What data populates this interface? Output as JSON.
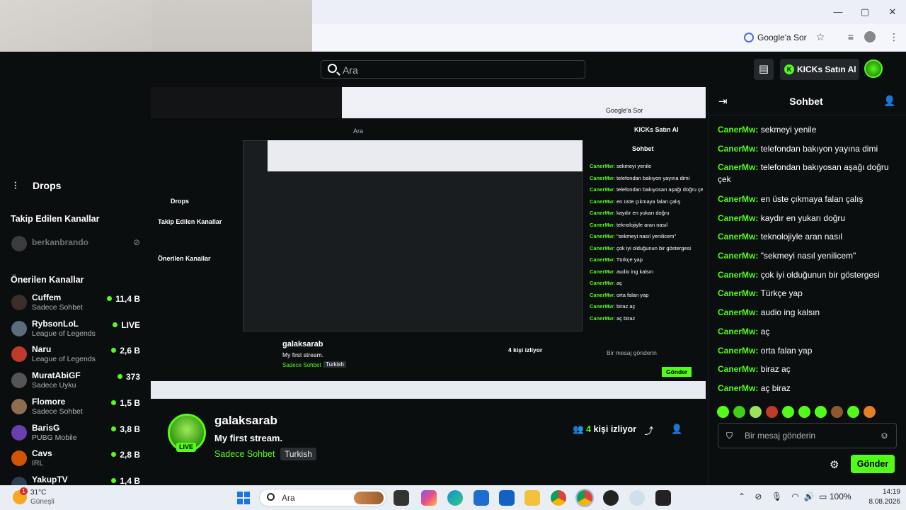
{
  "browser": {
    "google_sor": "Google'a Sor",
    "minimize": "—",
    "maximize": "▢",
    "close": "✕"
  },
  "header": {
    "search_placeholder": "Ara",
    "kicks_button": "KICKs Satın Al"
  },
  "sidebar": {
    "drops_label": "Drops",
    "followed_heading": "Takip Edilen Kanallar",
    "followed": [
      {
        "name": "berkanbrando"
      }
    ],
    "recommended_heading": "Önerilen Kanallar",
    "recommended": [
      {
        "name": "Cuffem",
        "category": "Sadece Sohbet",
        "viewers": "11,4 B",
        "color": "#3b2f2a"
      },
      {
        "name": "RybsonLoL",
        "category": "League of Legends",
        "viewers": "LIVE",
        "color": "#5a6c7e"
      },
      {
        "name": "Naru",
        "category": "League of Legends",
        "viewers": "2,6 B",
        "color": "#c0392b"
      },
      {
        "name": "MuratAbiGF",
        "category": "Sadece Uyku",
        "viewers": "373",
        "color": "#555"
      },
      {
        "name": "Flomore",
        "category": "Sadece Sohbet",
        "viewers": "1,5 B",
        "color": "#8e6e53"
      },
      {
        "name": "BarisG",
        "category": "PUBG Mobile",
        "viewers": "3,8 B",
        "color": "#6c3fb0"
      },
      {
        "name": "Cavs",
        "category": "IRL",
        "viewers": "2,8 B",
        "color": "#d35400"
      },
      {
        "name": "YakupTV",
        "category": "",
        "viewers": "1,4 B",
        "color": "#2c3e50"
      }
    ]
  },
  "stream": {
    "streamer": "galaksarab",
    "live_label": "LIVE",
    "title": "My first stream.",
    "category": "Sadece Sohbet",
    "tag": "Turkish",
    "viewer_count": "4",
    "viewer_label": "kişi izliyor"
  },
  "chat": {
    "title": "Sohbet",
    "messages": [
      {
        "user": "CanerMw:",
        "text": "sekmeyi yenile"
      },
      {
        "user": "CanerMw:",
        "text": "telefondan bakıyon yayına dimi"
      },
      {
        "user": "CanerMw:",
        "text": "telefondan bakıyosan aşağı doğru çek"
      },
      {
        "user": "CanerMw:",
        "text": "en üste çıkmaya falan çalış"
      },
      {
        "user": "CanerMw:",
        "text": "kaydır en yukarı doğru"
      },
      {
        "user": "CanerMw:",
        "text": "teknolojiyle aran nasıl"
      },
      {
        "user": "CanerMw:",
        "text": "\"sekmeyi nasıl yenilicem\""
      },
      {
        "user": "CanerMw:",
        "text": "çok iyi olduğunun bir göstergesi"
      },
      {
        "user": "CanerMw:",
        "text": "Türkçe yap"
      },
      {
        "user": "CanerMw:",
        "text": "audio ing kalsın"
      },
      {
        "user": "CanerMw:",
        "text": "aç"
      },
      {
        "user": "CanerMw:",
        "text": "orta falan yap"
      },
      {
        "user": "CanerMw:",
        "text": "biraz aç"
      },
      {
        "user": "CanerMw:",
        "text": "aç biraz"
      }
    ],
    "input_placeholder": "Bir mesaj gönderin",
    "send_label": "Gönder",
    "emote_colors": [
      "#53fc18",
      "#3fd016",
      "#9be15d",
      "#c0392b",
      "#53fc18",
      "#53fc18",
      "#53fc18",
      "#8e5a2b",
      "#53fc18",
      "#e67e22"
    ]
  },
  "taskbar": {
    "temperature": "31°C",
    "condition": "Güneşli",
    "badge": "1",
    "search_placeholder": "Ara",
    "battery": "100%",
    "time": "14:19",
    "date": "8.08.2026"
  },
  "preview": {
    "streamer": "galaksarab",
    "title": "My first stream.",
    "category": "Sadece Sohbet",
    "tag": "Turkish",
    "viewers": "4 kişi izliyor",
    "chat_title": "Sohbet",
    "input_placeholder": "Bir mesaj gönderin",
    "send": "Gönder",
    "search": "Ara",
    "google": "Google'a Sor",
    "kicks": "KICKs Satın Al",
    "drops": "Drops",
    "followed": "Takip Edilen Kanallar",
    "recommended": "Önerilen Kanallar"
  }
}
